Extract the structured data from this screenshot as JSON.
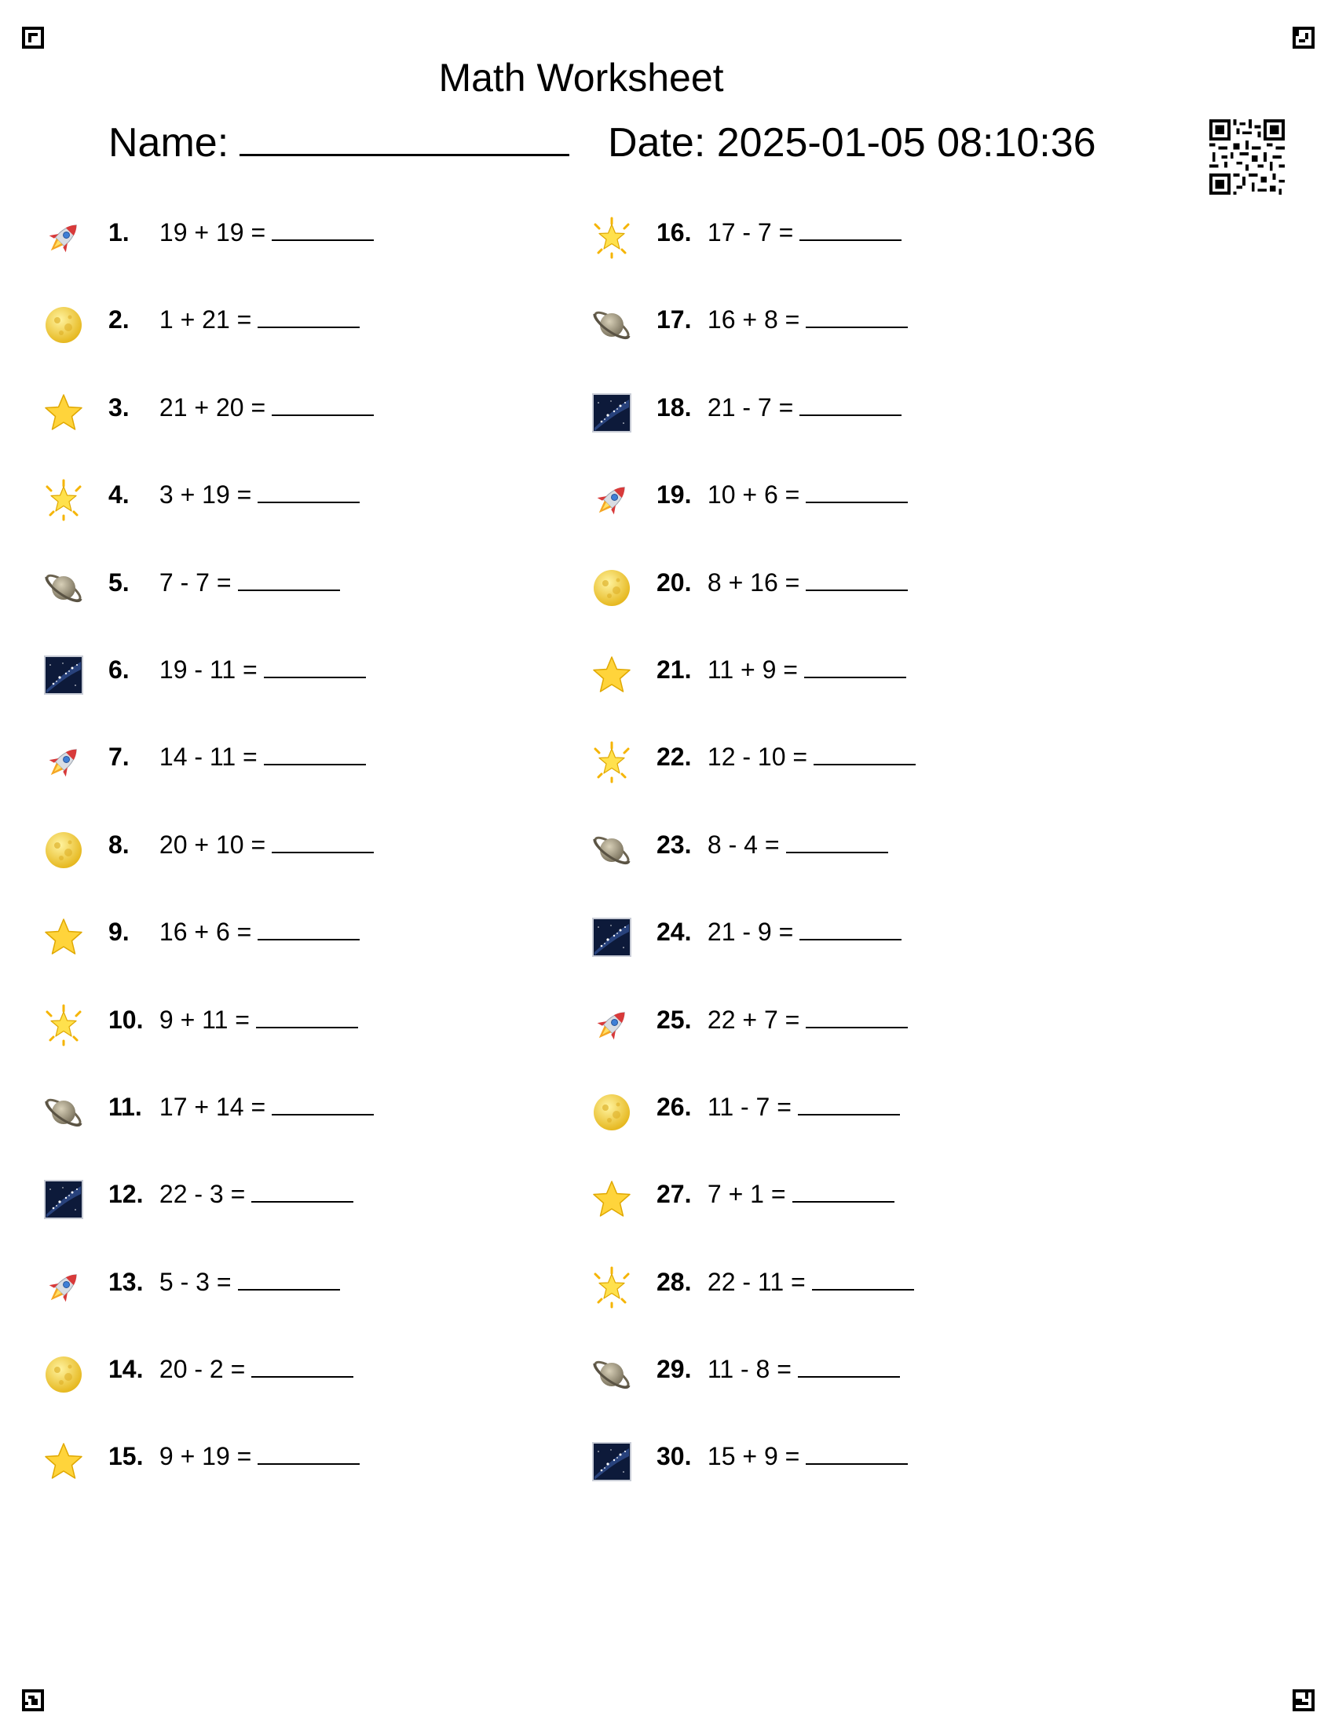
{
  "title": "Math Worksheet",
  "name_label": "Name:",
  "date_label": "Date: 2025-01-05 08:10:36",
  "problems_left": [
    {
      "num": "1.",
      "expr": "19 + 19 =",
      "icon": "rocket-icon"
    },
    {
      "num": "2.",
      "expr": "1 + 21 =",
      "icon": "moon-icon"
    },
    {
      "num": "3.",
      "expr": "21 + 20 =",
      "icon": "star-icon"
    },
    {
      "num": "4.",
      "expr": "3 + 19 =",
      "icon": "glowing-star-icon"
    },
    {
      "num": "5.",
      "expr": "7 - 7 =",
      "icon": "ringed-planet-icon"
    },
    {
      "num": "6.",
      "expr": "19 - 11 =",
      "icon": "milky-way-icon"
    },
    {
      "num": "7.",
      "expr": "14 - 11 =",
      "icon": "rocket-icon"
    },
    {
      "num": "8.",
      "expr": "20 + 10 =",
      "icon": "moon-icon"
    },
    {
      "num": "9.",
      "expr": "16 + 6 =",
      "icon": "star-icon"
    },
    {
      "num": "10.",
      "expr": "9 + 11 =",
      "icon": "glowing-star-icon"
    },
    {
      "num": "11.",
      "expr": "17 + 14 =",
      "icon": "ringed-planet-icon"
    },
    {
      "num": "12.",
      "expr": "22 - 3 =",
      "icon": "milky-way-icon"
    },
    {
      "num": "13.",
      "expr": "5 - 3 =",
      "icon": "rocket-icon"
    },
    {
      "num": "14.",
      "expr": "20 - 2 =",
      "icon": "moon-icon"
    },
    {
      "num": "15.",
      "expr": "9 + 19 =",
      "icon": "star-icon"
    }
  ],
  "problems_right": [
    {
      "num": "16.",
      "expr": "17 - 7 =",
      "icon": "glowing-star-icon"
    },
    {
      "num": "17.",
      "expr": "16 + 8 =",
      "icon": "ringed-planet-icon"
    },
    {
      "num": "18.",
      "expr": "21 - 7 =",
      "icon": "milky-way-icon"
    },
    {
      "num": "19.",
      "expr": "10 + 6 =",
      "icon": "rocket-icon"
    },
    {
      "num": "20.",
      "expr": "8 + 16 =",
      "icon": "moon-icon"
    },
    {
      "num": "21.",
      "expr": "11 + 9 =",
      "icon": "star-icon"
    },
    {
      "num": "22.",
      "expr": "12 - 10 =",
      "icon": "glowing-star-icon"
    },
    {
      "num": "23.",
      "expr": "8 - 4 =",
      "icon": "ringed-planet-icon"
    },
    {
      "num": "24.",
      "expr": "21 - 9 =",
      "icon": "milky-way-icon"
    },
    {
      "num": "25.",
      "expr": "22 + 7 =",
      "icon": "rocket-icon"
    },
    {
      "num": "26.",
      "expr": "11 - 7 =",
      "icon": "moon-icon"
    },
    {
      "num": "27.",
      "expr": "7 + 1 =",
      "icon": "star-icon"
    },
    {
      "num": "28.",
      "expr": "22 - 11 =",
      "icon": "glowing-star-icon"
    },
    {
      "num": "29.",
      "expr": "11 - 8 =",
      "icon": "ringed-planet-icon"
    },
    {
      "num": "30.",
      "expr": "15 + 9 =",
      "icon": "milky-way-icon"
    }
  ]
}
